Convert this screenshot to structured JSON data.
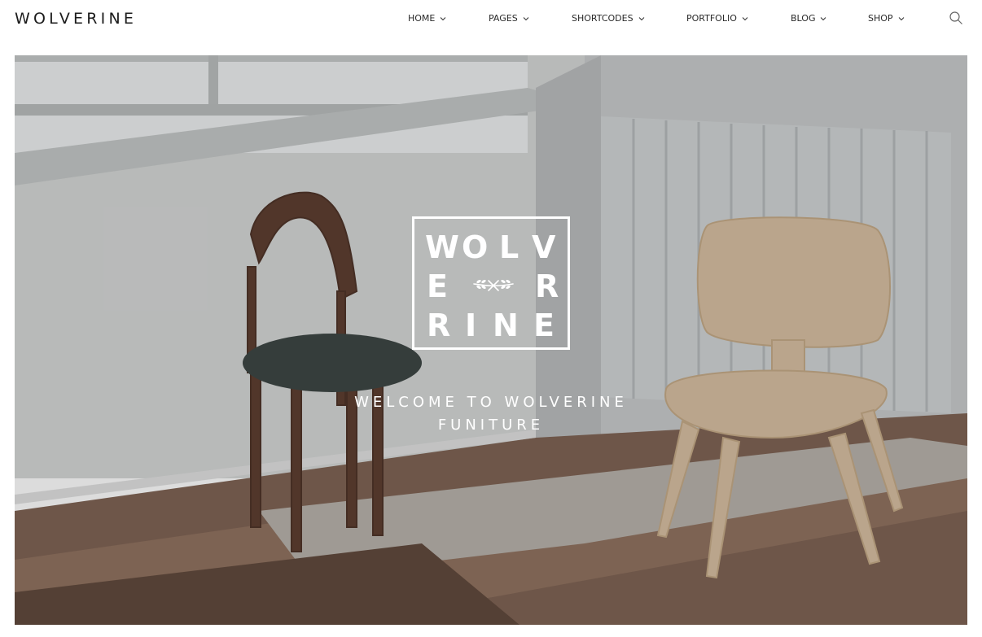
{
  "brand": {
    "logo_text": "WOLVERINE"
  },
  "nav": {
    "items": [
      {
        "label": "HOME"
      },
      {
        "label": "PAGES"
      },
      {
        "label": "SHORTCODES"
      },
      {
        "label": "PORTFOLIO"
      },
      {
        "label": "BLOG"
      },
      {
        "label": "SHOP"
      }
    ],
    "search_icon": "search-icon",
    "dropdown_icon": "chevron-down-icon"
  },
  "hero": {
    "badge": {
      "row1": [
        "W",
        "O",
        "L",
        "V"
      ],
      "row2": [
        "E",
        "R"
      ],
      "row3": [
        "R",
        "I",
        "N",
        "E"
      ],
      "ornament_icon": "laurel-sprig-icon"
    },
    "heading_line1": "WELCOME TO WOLVERINE",
    "heading_line2": "FUNITURE"
  },
  "colors": {
    "text_dark": "#1c1c1c",
    "overlay_text": "#ffffff",
    "wall": "#c9cdcc",
    "floor": "#8a6a55"
  }
}
